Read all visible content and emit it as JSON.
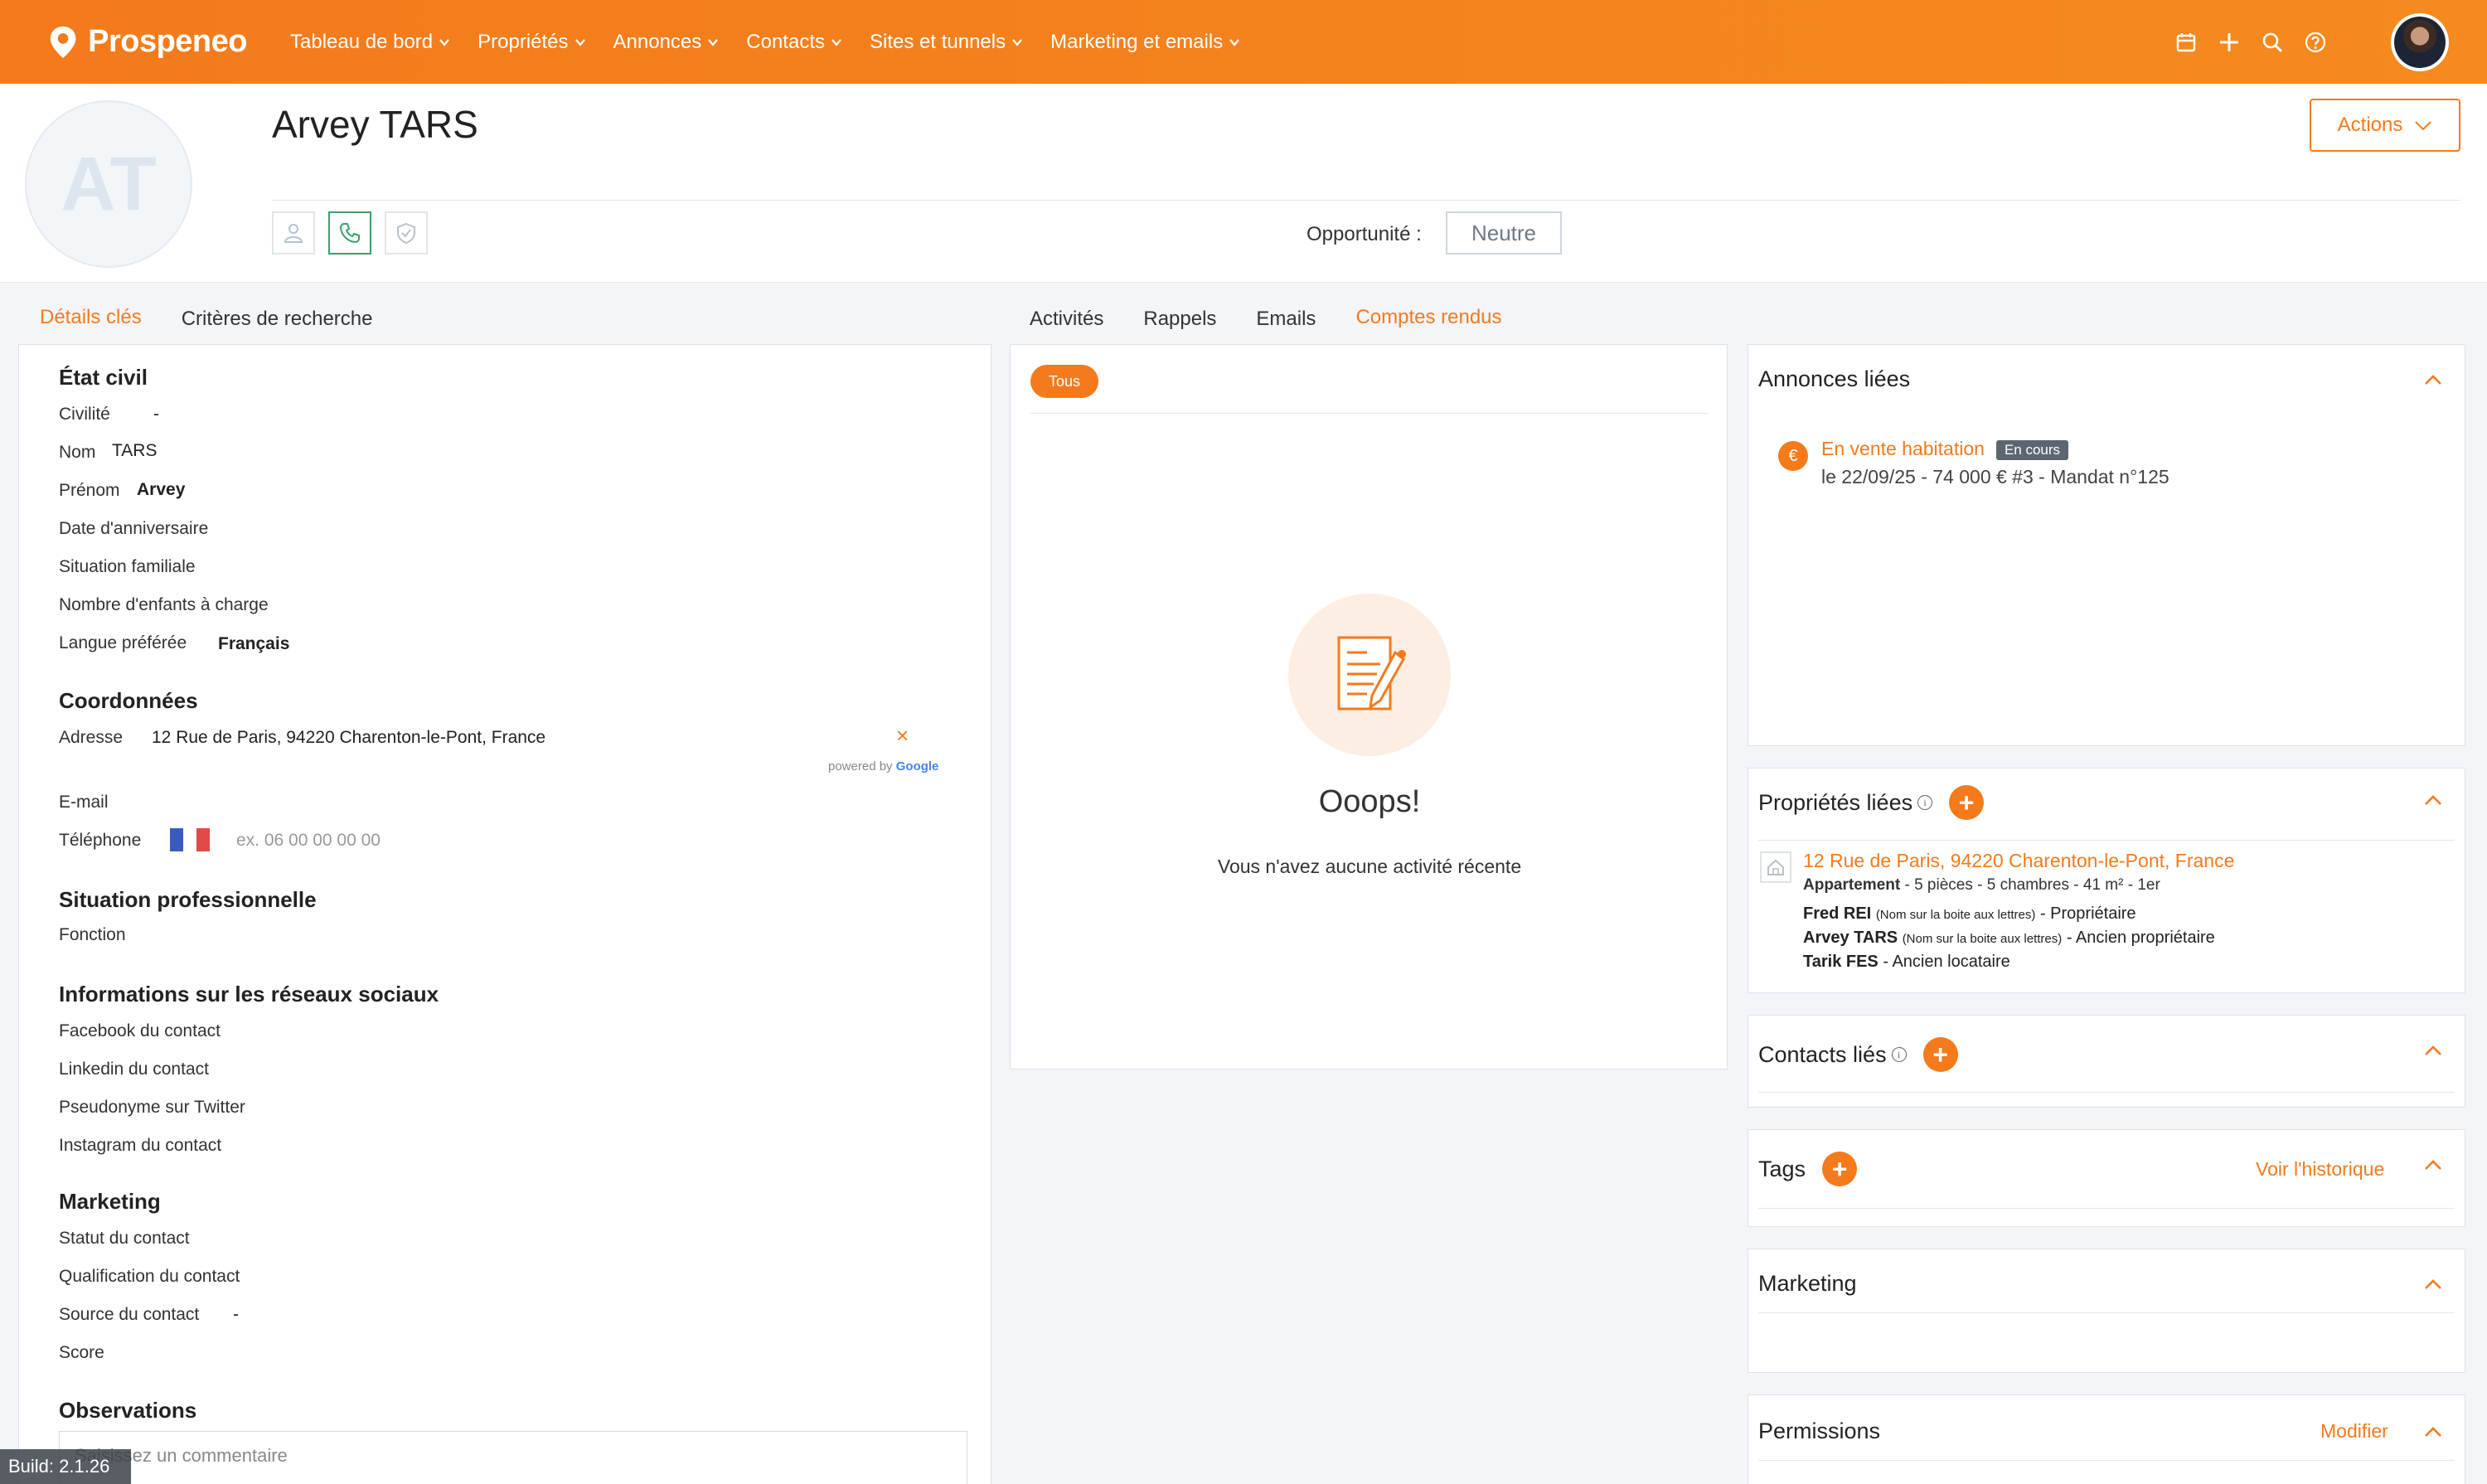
{
  "app": {
    "logo_text": "Prospeneo",
    "nav": [
      {
        "label": "Tableau de bord"
      },
      {
        "label": "Propriétés"
      },
      {
        "label": "Annonces"
      },
      {
        "label": "Contacts"
      },
      {
        "label": "Sites et tunnels"
      },
      {
        "label": "Marketing et emails"
      }
    ],
    "icons": [
      "calendar-icon",
      "plus-icon",
      "search-icon",
      "help-icon"
    ],
    "accent": "#f47a1c"
  },
  "header": {
    "initials": "AT",
    "name": "Arvey TARS",
    "actions_label": "Actions",
    "opportunity_label": "Opportunité :",
    "opportunity_value": "Neutre"
  },
  "left_tabs": [
    {
      "label": "Détails clés",
      "active": true
    },
    {
      "label": "Critères de recherche",
      "active": false
    }
  ],
  "mid_tabs": [
    {
      "label": "Activités",
      "active": false
    },
    {
      "label": "Rappels",
      "active": false
    },
    {
      "label": "Emails",
      "active": false
    },
    {
      "label": "Comptes rendus",
      "active": true
    }
  ],
  "details": {
    "etat_civil": {
      "title": "État civil",
      "civilite_label": "Civilité",
      "civilite_value": "-",
      "nom_label": "Nom",
      "nom_value": "TARS",
      "prenom_label": "Prénom",
      "prenom_value": "Arvey",
      "anniv_label": "Date d'anniversaire",
      "situation_label": "Situation familiale",
      "enfants_label": "Nombre d'enfants à charge",
      "langue_label": "Langue préférée",
      "langue_value": "Français"
    },
    "coordonnees": {
      "title": "Coordonnées",
      "adresse_label": "Adresse",
      "adresse_value": "12 Rue de Paris, 94220 Charenton-le-Pont, France",
      "clear": "×",
      "powered": "powered by",
      "powered_brand": "Google",
      "email_label": "E-mail",
      "tel_label": "Téléphone",
      "tel_placeholder": "ex. 06 00 00 00 00"
    },
    "pro": {
      "title": "Situation professionnelle",
      "fonction_label": "Fonction"
    },
    "social": {
      "title": "Informations sur les réseaux sociaux",
      "facebook": "Facebook du contact",
      "linkedin": "Linkedin du contact",
      "twitter": "Pseudonyme sur Twitter",
      "instagram": "Instagram du contact"
    },
    "marketing": {
      "title": "Marketing",
      "statut": "Statut du contact",
      "qualif": "Qualification du contact",
      "source": "Source du contact",
      "source_value": "-",
      "score": "Score"
    },
    "observations": {
      "title": "Observations",
      "placeholder": "Saisissez un commentaire"
    }
  },
  "activity": {
    "filter": "Tous",
    "empty_title": "Ooops!",
    "empty_text": "Vous n'avez aucune activité récente"
  },
  "annonces": {
    "title": "Annonces liées",
    "item_link": "En vente habitation",
    "item_badge": "En cours",
    "item_details": "le 22/09/25 - 74 000 € #3 - Mandat n°125"
  },
  "proprietes": {
    "title": "Propriétés liées",
    "address": "12 Rue de Paris, 94220 Charenton-le-Pont, France",
    "type": "Appartement",
    "specs": " - 5 pièces - 5 chambres - 41 m² - 1er",
    "people": [
      {
        "name": "Fred REI",
        "note": "(Nom sur la boite aux lettres)",
        "role": " - Propriétaire"
      },
      {
        "name": "Arvey TARS",
        "note": "(Nom sur la boite aux lettres)",
        "role": " - Ancien propriétaire"
      },
      {
        "name": "Tarik FES",
        "note": "",
        "role": " - Ancien locataire"
      }
    ]
  },
  "contacts_lies": {
    "title": "Contacts liés"
  },
  "tags": {
    "title": "Tags",
    "history_link": "Voir l'historique"
  },
  "marketing_card": {
    "title": "Marketing"
  },
  "permissions": {
    "title": "Permissions",
    "edit_link": "Modifier"
  },
  "build": "Build: 2.1.26"
}
